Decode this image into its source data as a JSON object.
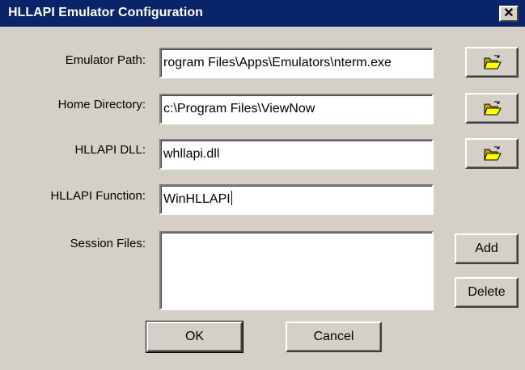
{
  "window": {
    "title": "HLLAPI Emulator Configuration",
    "close_glyph": "✕",
    "title_bar_color": "#0a246a",
    "face_color": "#d4d0c8"
  },
  "fields": {
    "emulator_path": {
      "label": "Emulator Path:",
      "value": "C:\\Program Files\\Apps\\Emulators\\nterm.exe",
      "visible_text": "rogram Files\\Apps\\Emulators\\nterm.exe"
    },
    "home_directory": {
      "label": "Home Directory:",
      "value": "c:\\Program Files\\ViewNow"
    },
    "hllapi_dll": {
      "label": "HLLAPI DLL:",
      "value": "whllapi.dll"
    },
    "hllapi_function": {
      "label": "HLLAPI Function:",
      "value": "WinHLLAPI"
    },
    "session_files": {
      "label": "Session Files:",
      "items": []
    }
  },
  "buttons": {
    "browse_icon": "folder-open-icon",
    "add": "Add",
    "delete": "Delete",
    "ok": "OK",
    "cancel": "Cancel"
  }
}
